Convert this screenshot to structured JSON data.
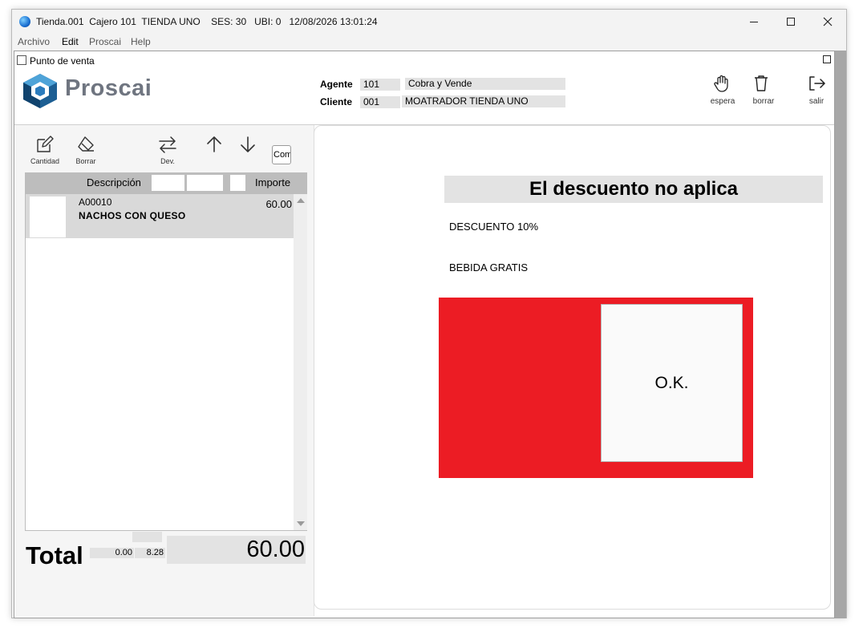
{
  "window": {
    "title": "Tienda.001  Cajero 101  TIENDA UNO    SES: 30   UBI: 0   12/08/2026 13:01:24"
  },
  "menu": [
    "Archivo",
    "Edit",
    "Proscai",
    "Help"
  ],
  "inner_window": {
    "title": "Punto de venta"
  },
  "brand": {
    "name": "Proscai"
  },
  "agente": {
    "label": "Agente",
    "code": "101",
    "name": "Cobra y Vende"
  },
  "cliente": {
    "label": "Cliente",
    "code": "001",
    "name": "MOATRADOR TIENDA UNO"
  },
  "toolbar_right": {
    "espera": "espera",
    "borrar": "borrar",
    "salir": "salir"
  },
  "toolbar_left": {
    "cantidad": "Cantidad",
    "borrar": "Borrar",
    "dev": "Dev.",
    "com": "Com"
  },
  "grid": {
    "col_descripcion": "Descripción",
    "col_importe": "Importe",
    "rows": [
      {
        "code": "A00010",
        "description": "NACHOS CON QUESO",
        "amount": "60.00"
      }
    ]
  },
  "totals": {
    "label": "Total",
    "value_a": "0.00",
    "value_b": "8.28",
    "total": "60.00"
  },
  "message": {
    "title": "El descuento no aplica",
    "lines": [
      "DESCUENTO 10%",
      "BEBIDA GRATIS"
    ],
    "ok_label": "O.K."
  },
  "colors": {
    "alert_red": "#ec1c24",
    "logo_blue": "#1c6ea8",
    "logo_text": "#6f7580"
  }
}
